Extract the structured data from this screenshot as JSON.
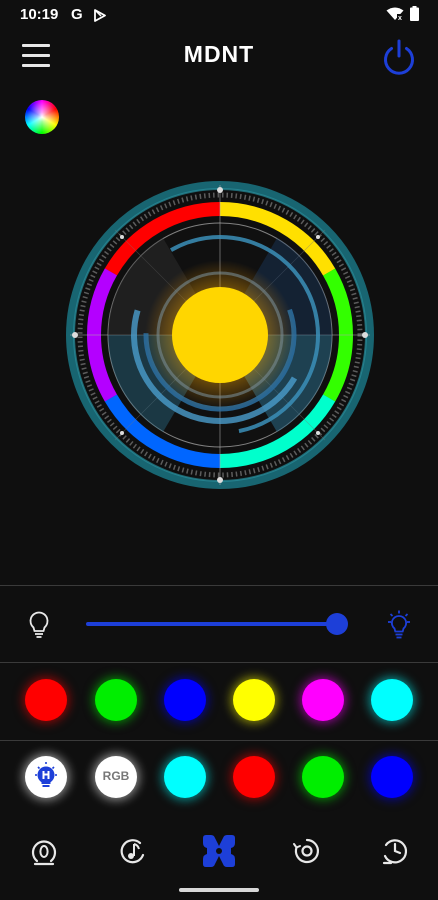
{
  "status_bar": {
    "time": "10:19",
    "g_letter": "G"
  },
  "header": {
    "title": "MDNT"
  },
  "dial": {
    "center_color": "#ffd600"
  },
  "brightness": {
    "level_percent": 100
  },
  "color_presets": [
    {
      "name": "red",
      "color": "#ff0000"
    },
    {
      "name": "green",
      "color": "#00ee00"
    },
    {
      "name": "blue",
      "color": "#0000ff"
    },
    {
      "name": "yellow",
      "color": "#ffff00"
    },
    {
      "name": "magenta",
      "color": "#ff00ff"
    },
    {
      "name": "cyan",
      "color": "#00ffff"
    }
  ],
  "mode_row": {
    "rgb_label": "RGB",
    "colors": [
      {
        "name": "cyan",
        "color": "#00ffff"
      },
      {
        "name": "red",
        "color": "#ff0000"
      },
      {
        "name": "green",
        "color": "#00ee00"
      },
      {
        "name": "blue",
        "color": "#0000ff"
      }
    ]
  },
  "nav": {
    "active_item": "mdnt",
    "active_color": "#1d3fd8"
  }
}
